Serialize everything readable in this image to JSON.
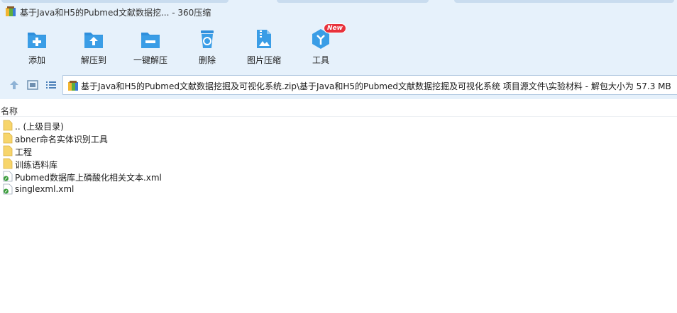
{
  "window": {
    "title": "基于Java和H5的Pubmed文献数据挖... - 360压缩"
  },
  "toolbar": {
    "items": [
      {
        "label": "添加",
        "icon": "add-file-icon"
      },
      {
        "label": "解压到",
        "icon": "extract-to-icon"
      },
      {
        "label": "一键解压",
        "icon": "one-click-extract-icon"
      },
      {
        "label": "删除",
        "icon": "recycle-bin-icon"
      },
      {
        "label": "图片压缩",
        "icon": "image-compress-icon"
      },
      {
        "label": "工具",
        "icon": "tools-icon",
        "badge": "New"
      }
    ]
  },
  "address": {
    "path": "基于Java和H5的Pubmed文献数据挖掘及可视化系统.zip\\基于Java和H5的Pubmed文献数据挖掘及可视化系统 项目源文件\\实验材料 - 解包大小为 57.3 MB"
  },
  "list": {
    "column_name": "名称",
    "rows": [
      {
        "name": ".. (上级目录)",
        "type": "folder"
      },
      {
        "name": "abner命名实体识别工具",
        "type": "folder"
      },
      {
        "name": "工程",
        "type": "folder"
      },
      {
        "name": "训练语料库",
        "type": "folder"
      },
      {
        "name": "Pubmed数据库上磷酸化相关文本.xml",
        "type": "xml"
      },
      {
        "name": "singlexml.xml",
        "type": "xml"
      }
    ]
  },
  "colors": {
    "toolbar_bg": "#e6f1fb",
    "icon_blue": "#2f8fdc",
    "badge_red": "#e8323c",
    "folder_yellow": "#f7d56b"
  }
}
